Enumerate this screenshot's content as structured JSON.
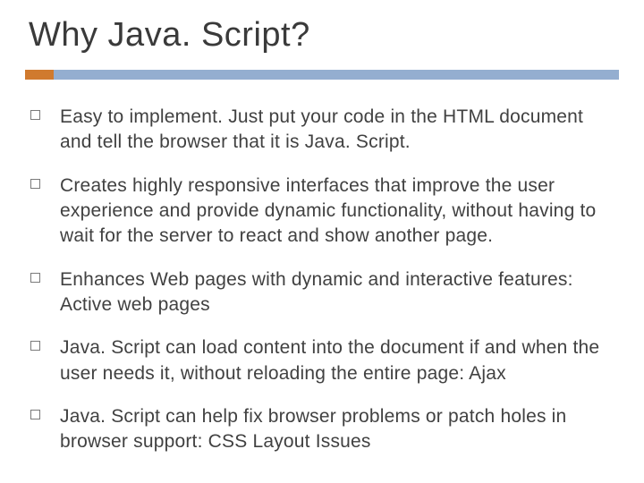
{
  "title": "Why Java. Script?",
  "bullets": [
    "Easy to implement. Just put your code in the HTML document and tell the browser that it is Java. Script.",
    "Creates highly responsive interfaces that improve the user experience and provide dynamic functionality, without having to wait for the server to react and show another page.",
    "Enhances Web pages with dynamic and interactive features: Active web pages",
    "Java. Script can load content into the document if and when the user needs it, without reloading the entire page: Ajax",
    "Java. Script can help fix browser problems or patch holes in browser support: CSS Layout Issues"
  ],
  "accent_color": "#d07a2e",
  "bar_color": "#94aed0"
}
